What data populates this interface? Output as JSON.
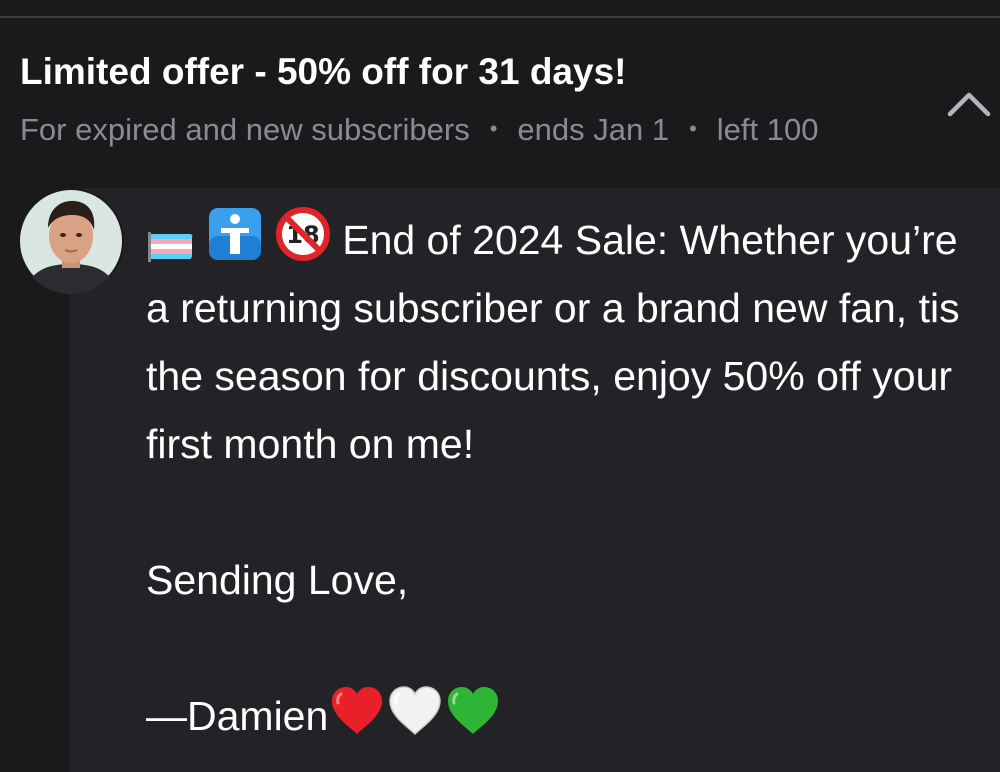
{
  "offer": {
    "title": "Limited offer - 50% off for 31 days!",
    "audience": "For expired and new subscribers",
    "ends": "ends Jan 1",
    "left": "left 100",
    "separator": "•"
  },
  "message": {
    "heading": "End of 2024 Sale: Whether you’re a returning subscriber or a brand new fan, tis the season for discounts, enjoy 50% off your first month on me!",
    "closing": "Sending Love,",
    "signature": "—Damien",
    "leading_emojis": [
      "transgender-flag-icon",
      "person-icon",
      "no-one-under-eighteen-icon"
    ],
    "trailing_emojis": [
      "red-heart-icon",
      "white-heart-icon",
      "green-heart-icon"
    ]
  },
  "colors": {
    "background": "#1a1a1c",
    "card": "#232327",
    "text_primary": "#ffffff",
    "text_secondary": "#8a8b92"
  }
}
